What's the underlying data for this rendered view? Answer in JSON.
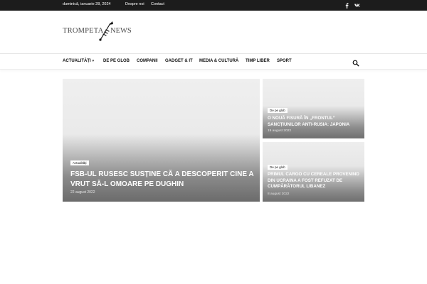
{
  "topbar": {
    "date": "duminică, ianuarie 28, 2024",
    "links": [
      "Despre noi",
      "Contact"
    ],
    "social": [
      "facebook-icon",
      "vk-icon"
    ]
  },
  "logo": {
    "word1": "TROMPETA",
    "word2": "NEWS"
  },
  "nav": {
    "items": [
      "ACTUALITĂȚI",
      "DE PE GLOB",
      "COMPANII",
      "GADGET & IT",
      "MEDIA & CULTURĂ",
      "TIMP LIBER",
      "SPORT"
    ],
    "caret": "▾"
  },
  "articles": [
    {
      "category": "Actualități",
      "title": "FSB-ul rusesc susține că a descoperit cine a vrut să-l omoare pe Dughin",
      "date": "22 august 2022"
    },
    {
      "category": "De pe glob",
      "title": "O nouă fisură în „frontul” sancțiunilor anti-Rusia: Japonia",
      "date": "19 august 2022"
    },
    {
      "category": "De pe glob",
      "title": "Primul cargo cu cereale provenind din Ucraina a fost refuzat de cumpărătorul libanez",
      "date": "8 august 2022"
    }
  ],
  "colors": {
    "topbar_bg": "#1c1c1c",
    "nav_text": "#111111",
    "card_text": "#ffffff"
  }
}
